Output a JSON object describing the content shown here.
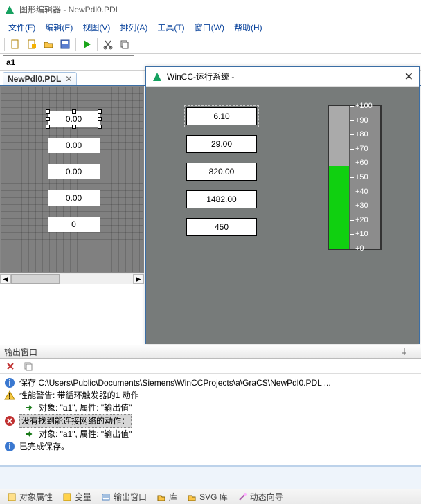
{
  "title": "图形编辑器 - NewPdl0.PDL",
  "menu": [
    "文件(F)",
    "编辑(E)",
    "视图(V)",
    "排列(A)",
    "工具(T)",
    "窗口(W)",
    "帮助(H)"
  ],
  "object_name": "a1",
  "tab": {
    "label": "NewPdl0.PDL"
  },
  "editor_fields": [
    "0.00",
    "0.00",
    "0.00",
    "0.00",
    "0"
  ],
  "runtime": {
    "title": "WinCC-运行系统 -",
    "fields": [
      "6.10",
      "29.00",
      "820.00",
      "1482.00",
      "450"
    ],
    "meter": {
      "ticks": [
        "+100",
        "+90",
        "+80",
        "+70",
        "+60",
        "+50",
        "+40",
        "+30",
        "+20",
        "+10",
        "+0"
      ],
      "fill_pct": 58
    }
  },
  "chart_data": {
    "type": "bar",
    "orientation": "vertical-thermometer",
    "title": "",
    "ylim": [
      0,
      100
    ],
    "ticks": [
      0,
      10,
      20,
      30,
      40,
      50,
      60,
      70,
      80,
      90,
      100
    ],
    "values": [
      58
    ]
  },
  "output": {
    "header": "输出窗口",
    "rows": [
      {
        "icon": "info",
        "text": "保存 C:\\Users\\Public\\Documents\\Siemens\\WinCCProjects\\a\\GraCS\\NewPdl0.PDL ..."
      },
      {
        "icon": "warn",
        "text": "性能警告: 带循环触发器的1 动作"
      },
      {
        "icon": "arrow",
        "text": "对象: \"a1\", 属性: \"输出值\"",
        "indent": true
      },
      {
        "icon": "err",
        "text": "没有找到能连接网络的动作：",
        "selected": true
      },
      {
        "icon": "arrow",
        "text": "对象: \"a1\", 属性: \"输出值\"",
        "indent": true
      },
      {
        "icon": "info",
        "text": "已完成保存。"
      }
    ]
  },
  "bottom_tabs": [
    "对象属性",
    "变量",
    "输出窗口",
    "库",
    "SVG 库",
    "动态向导"
  ]
}
